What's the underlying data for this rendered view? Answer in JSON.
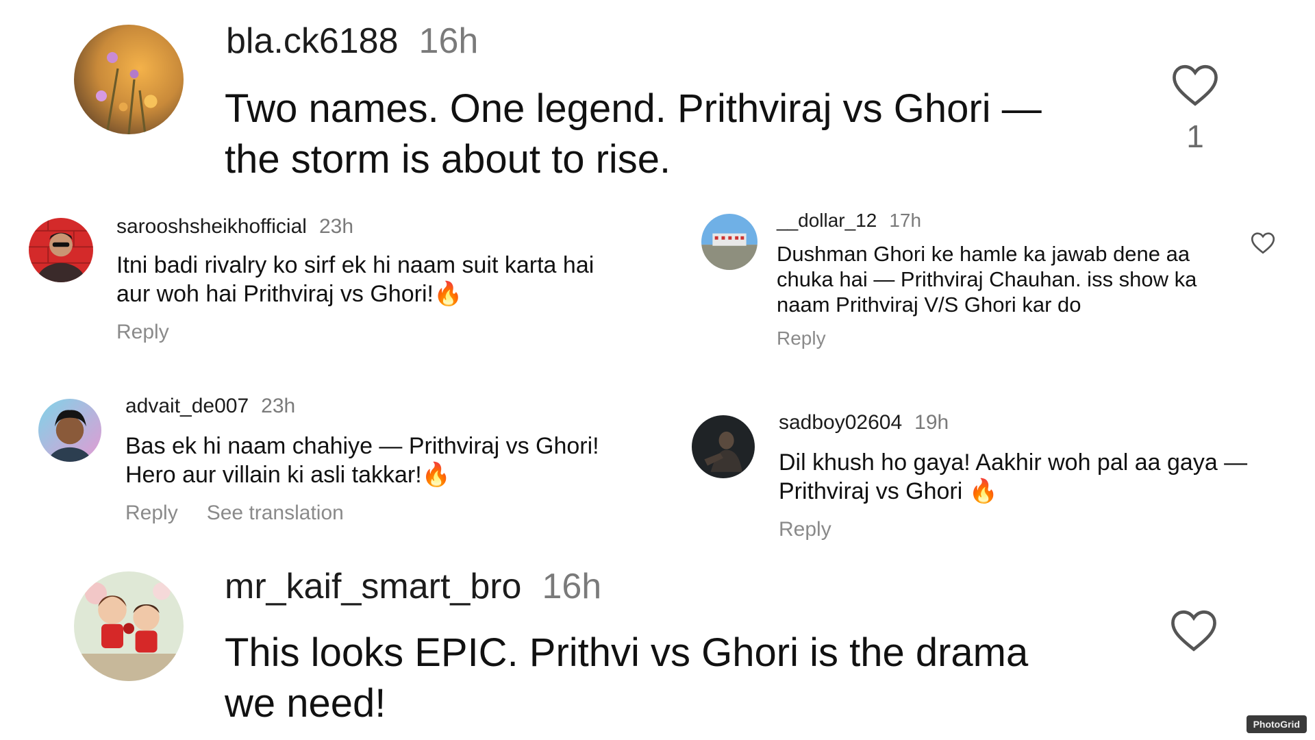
{
  "comments": [
    {
      "username": "bla.ck6188",
      "time": "16h",
      "lines": [
        "Two names. One legend. Prithviraj vs Ghori —",
        "the storm is about to rise."
      ],
      "likes": "1",
      "avatar_icon": "flowers-photo-avatar"
    },
    {
      "username": "sarooshsheikhofficial",
      "time": "23h",
      "lines": [
        "Itni badi rivalry ko sirf ek hi naam suit karta hai",
        "aur woh hai Prithviraj vs Ghori!"
      ],
      "emoji": "🔥",
      "reply": "Reply",
      "avatar_icon": "man-sunglasses-avatar"
    },
    {
      "username": "__dollar_12",
      "time": "17h",
      "lines": [
        "Dushman Ghori ke hamle ka jawab dene aa",
        "chuka hai — Prithviraj Chauhan. iss show ka",
        "naam Prithviraj V/S Ghori kar do"
      ],
      "reply": "Reply",
      "avatar_icon": "building-photo-avatar"
    },
    {
      "username": "advait_de007",
      "time": "23h",
      "lines": [
        "Bas ek hi naam chahiye — Prithviraj vs Ghori!",
        "Hero aur villain ki asli takkar!"
      ],
      "emoji": "🔥",
      "reply": "Reply",
      "see_translation": "See translation",
      "avatar_icon": "man-portrait-avatar"
    },
    {
      "username": "sadboy02604",
      "time": "19h",
      "lines": [
        "Dil khush ho gaya! Aakhir woh pal aa gaya —",
        "Prithviraj vs Ghori "
      ],
      "emoji": "🔥",
      "reply": "Reply",
      "avatar_icon": "dark-photo-avatar"
    },
    {
      "username": "mr_kaif_smart_bro",
      "time": "16h",
      "lines": [
        "This looks EPIC. Prithvi vs Ghori is the drama",
        "we need!"
      ],
      "avatar_icon": "cartoon-couple-avatar"
    }
  ],
  "watermark": "PhotoGrid",
  "colors": {
    "text": "#111111",
    "muted": "#7a7a7a",
    "fire": "#ff6a00"
  }
}
